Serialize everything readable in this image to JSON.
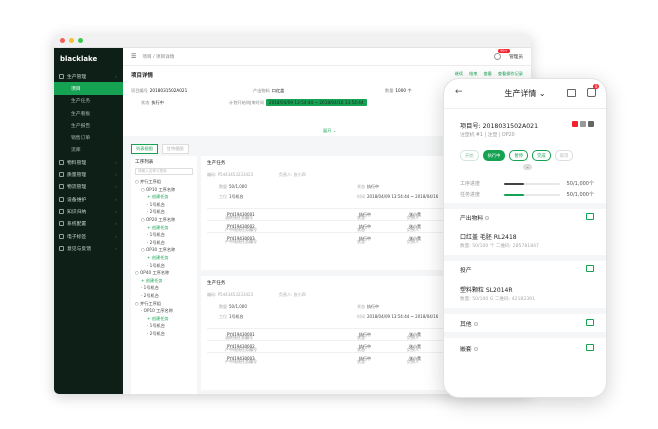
{
  "colors": {
    "brand": "#15a353",
    "sidebar": "#0e1f17",
    "danger": "#f5222d"
  },
  "app": {
    "logo": "blacklake",
    "breadcrumb": "项目 / 项目详情",
    "notif_count": "99+",
    "user": "管理员",
    "menu_icon": "menu-icon"
  },
  "sidebar": {
    "items": [
      {
        "label": "生产管理",
        "level": 0,
        "active_parent": true
      },
      {
        "label": "项目",
        "level": 1,
        "active": true
      },
      {
        "label": "生产任务",
        "level": 1
      },
      {
        "label": "生产看板",
        "level": 1
      },
      {
        "label": "生产报告",
        "level": 1
      },
      {
        "label": "销售订单",
        "level": 1
      },
      {
        "label": "流库",
        "level": 1
      },
      {
        "label": "物料管理",
        "level": 0
      },
      {
        "label": "质量管理",
        "level": 0
      },
      {
        "label": "物流管理",
        "level": 0
      },
      {
        "label": "设备维护",
        "level": 0
      },
      {
        "label": "知识归纳",
        "level": 0
      },
      {
        "label": "系统配置",
        "level": 0
      },
      {
        "label": "电子标签",
        "level": 0
      },
      {
        "label": "意见与反馈",
        "level": 0
      }
    ]
  },
  "detail": {
    "title": "项目详情",
    "actions": [
      "继续",
      "结束",
      "查看",
      "查看操作记录"
    ],
    "project_no_label": "项目编号",
    "project_no": "2018031502A021",
    "product_label": "产出物料",
    "product": "口红盖",
    "qty_label": "数量",
    "qty": "1000 个",
    "status_label": "状态",
    "status": "执行中",
    "plan_label": "计划开始/结束时间",
    "plan": "2018/04/09 13:54:44 ~ 2018/04/16 13:54:44",
    "expand": "展开"
  },
  "views": {
    "list": "列表视图",
    "gantt": "甘特视图"
  },
  "tree": {
    "title": "工序列表",
    "search_placeholder": "请输入名称与搜索",
    "nodes": [
      {
        "label": "并行工序组",
        "level": 0
      },
      {
        "label": "OP10 工序名称",
        "level": 1
      },
      {
        "label": "+ 创建任务",
        "level": 2,
        "style": "green"
      },
      {
        "label": "1号机台",
        "level": 2
      },
      {
        "label": "2号机台",
        "level": 2
      },
      {
        "label": "OP20 工序名称",
        "level": 1
      },
      {
        "label": "+ 创建任务",
        "level": 2,
        "style": "green"
      },
      {
        "label": "1号机台",
        "level": 2
      },
      {
        "label": "2号机台",
        "level": 2
      },
      {
        "label": "OP30 工序名称",
        "level": 1
      },
      {
        "label": "+ 创建任务",
        "level": 2,
        "style": "green"
      },
      {
        "label": "1号机台",
        "level": 2
      },
      {
        "label": "OP40 工序名称",
        "level": 0
      },
      {
        "label": "+ 创建任务",
        "level": 1,
        "style": "green"
      },
      {
        "label": "1号机台",
        "level": 1
      },
      {
        "label": "2号机台",
        "level": 1
      },
      {
        "label": "并行工序组",
        "level": 0
      },
      {
        "label": "OP10 工序名称",
        "level": 1
      },
      {
        "label": "+ 创建任务",
        "level": 2,
        "style": "green"
      },
      {
        "label": "1号机台",
        "level": 2
      },
      {
        "label": "2号机台",
        "level": 2
      }
    ]
  },
  "cards": [
    {
      "title": "生产任务",
      "code_label": "编码:",
      "code": "P5443453233423",
      "owner_label": "负责人:",
      "owner": "张小四",
      "qty_label": "数量",
      "qty": "50/1,000",
      "status_label": "状态",
      "status": "执行中",
      "station_label": "工位",
      "station": "1号机台",
      "time_label": "时间",
      "time": "2018/04/09 13:54:44 ~ 2018/04/16",
      "rows": [
        {
          "k": "流转线任务编号",
          "v": "PY419430001",
          "status": "执行中",
          "owner": "张小黑"
        },
        {
          "k": "产中线线任务编号",
          "v": "PY419430002",
          "status": "执行中",
          "owner": "张小黑"
        },
        {
          "k": "产中线线任务编号",
          "v": "PY419430003",
          "status": "执行中",
          "owner": "张小黑"
        }
      ]
    },
    {
      "title": "生产任务",
      "code_label": "编码:",
      "code": "P5443453233423",
      "owner_label": "负责人:",
      "owner": "张小四",
      "qty_label": "数量",
      "qty": "50/1,000",
      "status_label": "状态",
      "status": "执行中",
      "station_label": "工位",
      "station": "1号机台",
      "time_label": "时间",
      "time": "2018/04/09 13:54:44 ~ 2018/04/16",
      "rows": [
        {
          "k": "流转线任务编号",
          "v": "PY419430001",
          "status": "执行中",
          "owner": "张小黑"
        },
        {
          "k": "产中线线任务编号",
          "v": "PY419430002",
          "status": "执行中",
          "owner": "张小黑"
        },
        {
          "k": "产中线线任务编号",
          "v": "PY419430003",
          "status": "执行中",
          "owner": "张小黑"
        }
      ]
    }
  ],
  "row_labels": {
    "status": "状态",
    "owner": "负责人"
  },
  "phone": {
    "title": "生产详情",
    "badge": "8",
    "project": "项目号: 2018031502A021",
    "sub": "注塑机 #1 | 注塑 | OP20",
    "steps": [
      "开始",
      "执行中",
      "暂停",
      "完成",
      "取消"
    ],
    "progress": [
      {
        "label": "工序进度",
        "value": "50/1,000个",
        "ratio": 0.35,
        "color": "#444444"
      },
      {
        "label": "任务进度",
        "value": "50/1,000个",
        "ratio": 0.35,
        "color": "#15a353"
      }
    ],
    "out_section": "产出物料",
    "out_name": "口红盖 毛胚 RL2418",
    "out_meta": "数量: 50/100 个   二维码: 285781847",
    "in_section": "投产",
    "in_name": "塑料颗粒 SL2014R",
    "in_meta": "数量: 50/100 G   二维码: 42182391",
    "other_section": "其他",
    "feed_section": "嵌套"
  }
}
